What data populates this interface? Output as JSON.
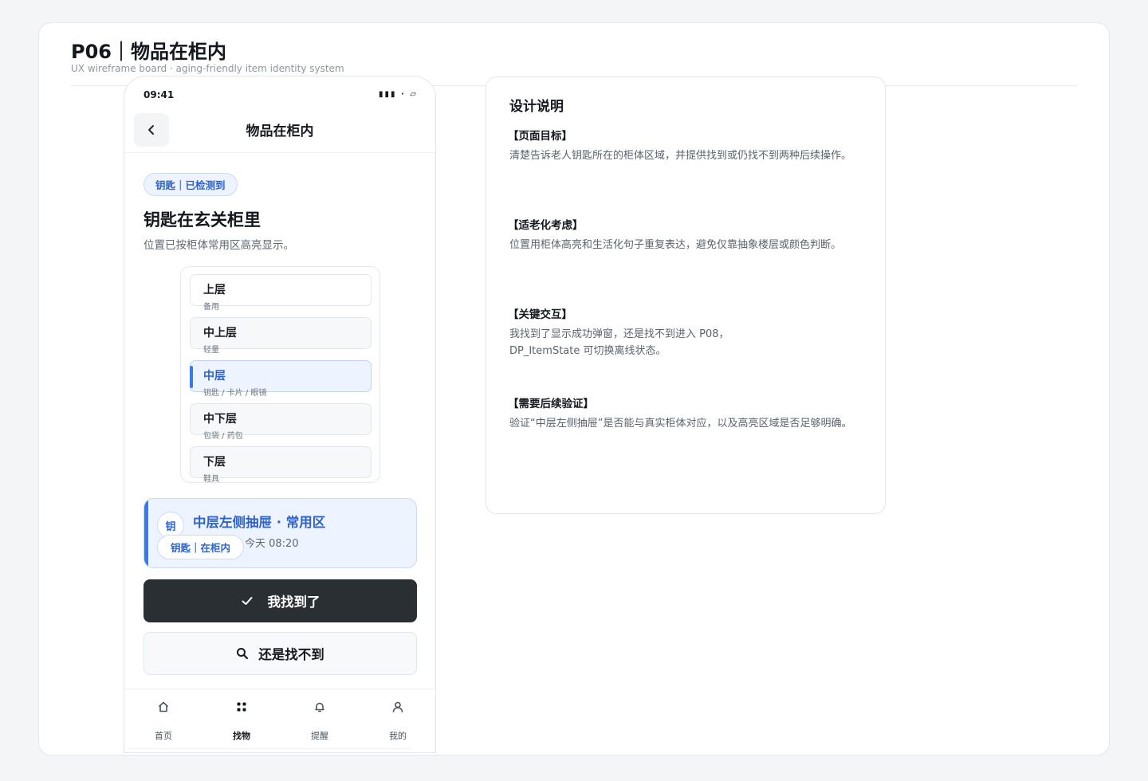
{
  "board": {
    "title": "P06｜物品在柜内",
    "subtitle": "UX wireframe board · aging-friendly item identity system"
  },
  "phone": {
    "status_time": "09:41",
    "status_icons": "▮▮▮ · ▱",
    "nav_title": "物品在柜内",
    "back_icon": "chevron-left-icon",
    "status_tag": "钥匙｜已检测到",
    "headline": "钥匙在玄关柜里",
    "subline": "位置已按柜体常用区高亮显示。",
    "shelves": [
      {
        "label": "上层",
        "hint": "备用",
        "active": false
      },
      {
        "label": "中上层",
        "hint": "轻量",
        "active": false
      },
      {
        "label": "中层",
        "hint": "钥匙 / 卡片 / 眼镜",
        "active": true
      },
      {
        "label": "中下层",
        "hint": "包袋 / 药包",
        "active": false
      },
      {
        "label": "下层",
        "hint": "鞋具",
        "active": false
      }
    ],
    "location": {
      "avatar": "钥",
      "title": "中层左侧抽屉 · 常用区",
      "chip": "钥匙｜在柜内",
      "time": "今天 08:20"
    },
    "buttons": {
      "found": "我找到了",
      "found_icon": "check-icon",
      "not_found": "还是找不到",
      "not_found_icon": "search-icon"
    },
    "tabs": [
      {
        "label": "首页",
        "icon": "home-icon",
        "active": false
      },
      {
        "label": "找物",
        "icon": "grid-icon",
        "active": true
      },
      {
        "label": "提醒",
        "icon": "bell-icon",
        "active": false
      },
      {
        "label": "我的",
        "icon": "user-icon",
        "active": false
      }
    ]
  },
  "notes": {
    "title": "设计说明",
    "sections": [
      {
        "heading": "【页面目标】",
        "body": [
          "清楚告诉老人钥匙所在的柜体区域，并提供找到或仍找不到两种后续操作。"
        ]
      },
      {
        "heading": "【适老化考虑】",
        "body": [
          "位置用柜体高亮和生活化句子重复表达，避免仅靠抽象楼层或颜色判断。"
        ]
      },
      {
        "heading": "【关键交互】",
        "body": [
          "我找到了显示成功弹窗，还是找不到进入 P08，",
          "DP_ItemState 可切换离线状态。"
        ]
      },
      {
        "heading": "【需要后续验证】",
        "body": [
          "验证“中层左侧抽屉”是否能与真实柜体对应，以及高亮区域是否足够明确。"
        ]
      }
    ]
  },
  "colors": {
    "accent": "#3b78f0",
    "accent_text": "#2e62c9",
    "accent_bg": "#eef4ff",
    "primary_button": "#2a2f33"
  }
}
